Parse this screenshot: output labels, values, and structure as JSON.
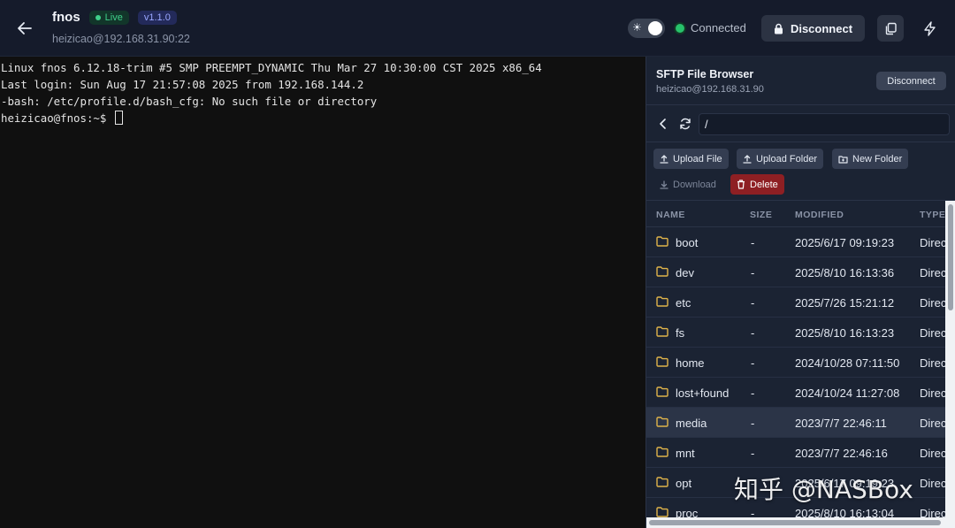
{
  "header": {
    "title": "fnos",
    "live_label": "Live",
    "version": "v1.1.0",
    "host": "heizicao@192.168.31.90:22",
    "theme_icon": "sun-icon",
    "status_label": "Connected",
    "disconnect_label": "Disconnect"
  },
  "terminal": {
    "lines": [
      "Linux fnos 6.12.18-trim #5 SMP PREEMPT_DYNAMIC Thu Mar 27 10:30:00 CST 2025 x86_64",
      "Last login: Sun Aug 17 21:57:08 2025 from 192.168.144.2",
      "-bash: /etc/profile.d/bash_cfg: No such file or directory"
    ],
    "prompt": "heizicao@fnos:~$"
  },
  "sftp": {
    "title": "SFTP File Browser",
    "host": "heizicao@192.168.31.90",
    "disconnect_label": "Disconnect",
    "path": "/",
    "actions": {
      "upload_file": "Upload File",
      "upload_folder": "Upload Folder",
      "new_folder": "New Folder",
      "download": "Download",
      "delete": "Delete"
    },
    "columns": {
      "name": "NAME",
      "size": "SIZE",
      "modified": "MODIFIED",
      "type": "TYPE"
    },
    "rows": [
      {
        "name": "boot",
        "size": "-",
        "modified": "2025/6/17 09:19:23",
        "type": "Directory"
      },
      {
        "name": "dev",
        "size": "-",
        "modified": "2025/8/10 16:13:36",
        "type": "Directory"
      },
      {
        "name": "etc",
        "size": "-",
        "modified": "2025/7/26 15:21:12",
        "type": "Directory"
      },
      {
        "name": "fs",
        "size": "-",
        "modified": "2025/8/10 16:13:23",
        "type": "Directory"
      },
      {
        "name": "home",
        "size": "-",
        "modified": "2024/10/28 07:11:50",
        "type": "Directory"
      },
      {
        "name": "lost+found",
        "size": "-",
        "modified": "2024/10/24 11:27:08",
        "type": "Directory"
      },
      {
        "name": "media",
        "size": "-",
        "modified": "2023/7/7 22:46:11",
        "type": "Directory"
      },
      {
        "name": "mnt",
        "size": "-",
        "modified": "2023/7/7 22:46:16",
        "type": "Directory"
      },
      {
        "name": "opt",
        "size": "-",
        "modified": "2025/6/17 09:19:23",
        "type": "Directory"
      },
      {
        "name": "proc",
        "size": "-",
        "modified": "2025/8/10 16:13:04",
        "type": "Directory"
      }
    ],
    "highlighted_row": "media"
  },
  "watermark": "知乎 @NASBox",
  "colors": {
    "accent_live": "#3fd08a",
    "connected": "#27c26b",
    "danger": "#8e1f23",
    "folder": "#e0b44a"
  }
}
